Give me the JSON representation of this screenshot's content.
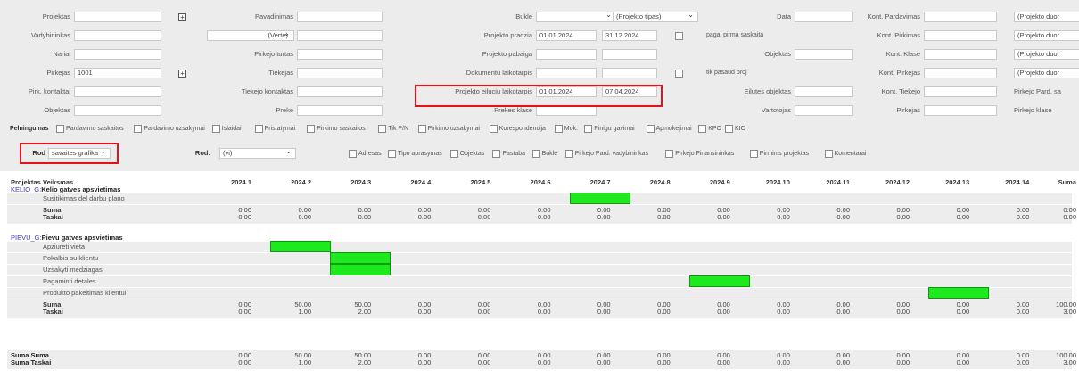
{
  "form": {
    "col1": [
      {
        "label": "Projektas",
        "value": ""
      },
      {
        "label": "Vadybininkas",
        "value": ""
      },
      {
        "label": "Narial",
        "value": ""
      },
      {
        "label": "Pirkejas",
        "value": "1001"
      },
      {
        "label": "Pirk. kontaktai",
        "value": ""
      },
      {
        "label": "Objektas",
        "value": ""
      }
    ],
    "col2": [
      {
        "label": "Pavadinimas",
        "value": ""
      },
      {
        "label": "",
        "value": "(Verte)"
      },
      {
        "label": "Pirkejo turtas",
        "value": ""
      },
      {
        "label": "Tiekejas",
        "value": ""
      },
      {
        "label": "Tiekejo kontaktas",
        "value": ""
      },
      {
        "label": "Preke",
        "value": ""
      }
    ],
    "col3": [
      {
        "label": "Bukle",
        "value": ""
      },
      {
        "label": "Projekto pradzia",
        "value": "01.01.2024",
        "value2": "31.12.2024"
      },
      {
        "label": "Projekto pabaiga",
        "value": ""
      },
      {
        "label": "Dokumentu laikotarpis",
        "value": ""
      },
      {
        "label": "Projekto eiluciu laikotarpis",
        "value": "01.01.2024",
        "value2": "07.04.2024"
      },
      {
        "label": "Prekes klase",
        "value": ""
      }
    ],
    "tipas_select": "(Projekto tipas)",
    "pagal_label": "pagal pirma saskaita",
    "tik_label": "tik pasaud proj",
    "col4": [
      {
        "label": "Data",
        "value": ""
      },
      {
        "label": "Objektas",
        "value": ""
      },
      {
        "label": "Eilutes objektas",
        "value": ""
      },
      {
        "label": "Vartotojas",
        "value": ""
      }
    ],
    "col5": [
      {
        "label": "Kont. Pardavimas",
        "value": ""
      },
      {
        "label": "Kont. Pirkimas",
        "value": ""
      },
      {
        "label": "Kont. Klase",
        "value": ""
      },
      {
        "label": "Kont. Pirkejas",
        "value": ""
      },
      {
        "label": "Kont. Tiekejo",
        "value": ""
      },
      {
        "label": "Pirkejas",
        "value": ""
      }
    ],
    "col6": [
      {
        "label": "",
        "value": "(Projekto duor"
      },
      {
        "label": "",
        "value": "(Projekto duor"
      },
      {
        "label": "",
        "value": "(Projekto duor"
      },
      {
        "label": "",
        "value": "(Projekto duor"
      },
      {
        "label": "Pirkejo Pard. sa",
        "value": ""
      },
      {
        "label": "Pirkejo klase",
        "value": ""
      }
    ],
    "pelningumas_label": "Pelningumas",
    "checkboxes1": [
      "Pardavimo saskaitos",
      "Pardavimo uzsakymai",
      "Islaidai",
      "Pristatymai",
      "Pirkimo saskaitos",
      "Tik P/N",
      "Pirkimo uzsakymai",
      "Korespondencija",
      "Mok.",
      "Pinigu gavimai",
      "Apmokejimai",
      "KPO",
      "KIO"
    ],
    "rod1_label": "Rod",
    "rod1_value": "savaites grafika",
    "rod2_label": "Rod:",
    "rod2_value": "(vi)",
    "checkboxes2": [
      "Adresas",
      "Tipo aprasymas",
      "Objektas",
      "Pastaba",
      "Bukle",
      "Pirkejo Pard. vadybininkas",
      "Pirkejo Finansininkas",
      "Pirminis projektas",
      "Komentarai"
    ]
  },
  "table": {
    "header_project": "Projektas",
    "header_activity": "Veiksmas",
    "weeks": [
      "2024.1",
      "2024.2",
      "2024.3",
      "2024.4",
      "2024.5",
      "2024.6",
      "2024.7",
      "2024.8",
      "2024.9",
      "2024.10",
      "2024.11",
      "2024.12",
      "2024.13",
      "2024.14"
    ],
    "header_sum": "Suma",
    "projects": [
      {
        "code": "KELIO_G:",
        "name": "Kelio gatves apsvietimas",
        "activities": [
          {
            "name": "Susitikimas del darbu plano",
            "week": 7
          }
        ],
        "sum_label": "Suma",
        "sum_values": [
          "0.00",
          "0.00",
          "0.00",
          "0.00",
          "0.00",
          "0.00",
          "0.00",
          "0.00",
          "0.00",
          "0.00",
          "0.00",
          "0.00",
          "0.00",
          "0.00",
          "0.00"
        ],
        "pts_label": "Taskai",
        "pts_values": [
          "0.00",
          "0.00",
          "0.00",
          "0.00",
          "0.00",
          "0.00",
          "0.00",
          "0.00",
          "0.00",
          "0.00",
          "0.00",
          "0.00",
          "0.00",
          "0.00",
          "0.00"
        ]
      },
      {
        "code": "PIEVU_G:",
        "name": "Pievu gatves apsvietimas",
        "activities": [
          {
            "name": "Apziureti vieta",
            "week": 2
          },
          {
            "name": "Pokalbis su klientu",
            "week": 3
          },
          {
            "name": "Uzsakyti medziagas",
            "week": 3
          },
          {
            "name": "Pagaminti detales",
            "week": 9
          },
          {
            "name": "Produkto pakeitimas klientui",
            "week": 13
          }
        ],
        "sum_label": "Suma",
        "sum_values": [
          "0.00",
          "50.00",
          "50.00",
          "0.00",
          "0.00",
          "0.00",
          "0.00",
          "0.00",
          "0.00",
          "0.00",
          "0.00",
          "0.00",
          "0.00",
          "0.00",
          "100.00"
        ],
        "pts_label": "Taskai",
        "pts_values": [
          "0.00",
          "1.00",
          "2.00",
          "0.00",
          "0.00",
          "0.00",
          "0.00",
          "0.00",
          "0.00",
          "0.00",
          "0.00",
          "0.00",
          "0.00",
          "0.00",
          "3.00"
        ]
      }
    ],
    "total_sum_label": "Suma Suma",
    "total_sum_values": [
      "0.00",
      "50.00",
      "50.00",
      "0.00",
      "0.00",
      "0.00",
      "0.00",
      "0.00",
      "0.00",
      "0.00",
      "0.00",
      "0.00",
      "0.00",
      "0.00",
      "100.00"
    ],
    "total_pts_label": "Suma Taskai",
    "total_pts_values": [
      "0.00",
      "1.00",
      "2.00",
      "0.00",
      "0.00",
      "0.00",
      "0.00",
      "0.00",
      "0.00",
      "0.00",
      "0.00",
      "0.00",
      "0.00",
      "0.00",
      "3.00"
    ]
  }
}
